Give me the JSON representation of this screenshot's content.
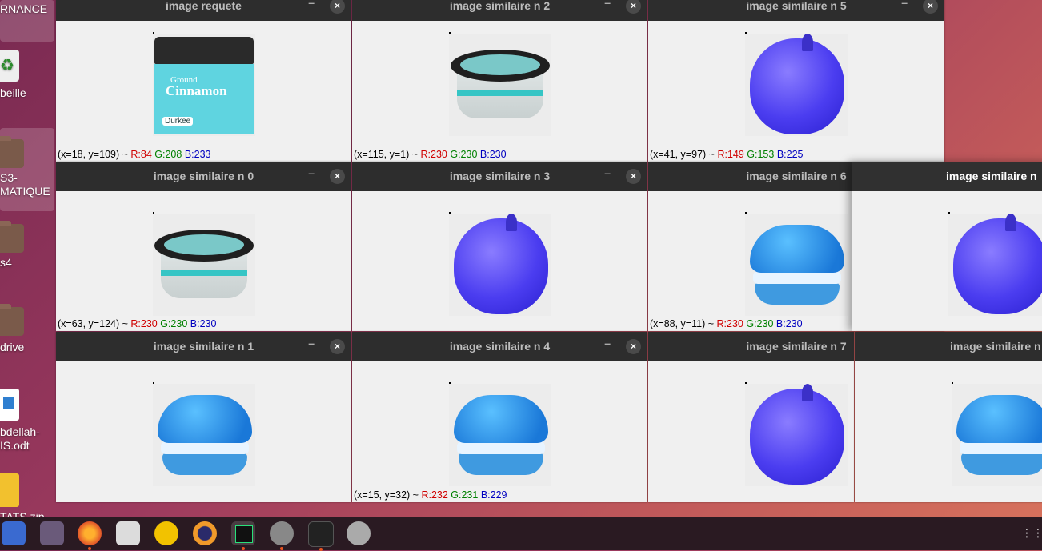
{
  "desktop": {
    "items": [
      {
        "label": "RNANCE"
      },
      {
        "label": "beille"
      },
      {
        "label": "S3-\nMATIQUE"
      },
      {
        "label": "s4"
      },
      {
        "label": "drive"
      },
      {
        "label": "bdellah-\nIS.odt"
      },
      {
        "label": "TATS.zip"
      }
    ]
  },
  "windows": [
    {
      "title": "image requete",
      "status": {
        "coord": "(x=18, y=109) ~",
        "r": "R:84",
        "g": "G:208",
        "b": "B:233"
      }
    },
    {
      "title": "image similaire n 2",
      "status": {
        "coord": "(x=115, y=1) ~",
        "r": "R:230",
        "g": "G:230",
        "b": "B:230"
      }
    },
    {
      "title": "image similaire n 5",
      "status": {
        "coord": "(x=41, y=97) ~",
        "r": "R:149",
        "g": "G:153",
        "b": "B:225"
      }
    },
    {
      "title": "image similaire n 0",
      "status": {
        "coord": "(x=63, y=124) ~",
        "r": "R:230",
        "g": "G:230",
        "b": "B:230"
      }
    },
    {
      "title": "image similaire n 3"
    },
    {
      "title": "image similaire n 6",
      "status": {
        "coord": "(x=88, y=11) ~",
        "r": "R:230",
        "g": "G:230",
        "b": "B:230"
      }
    },
    {
      "title": "image similaire n"
    },
    {
      "title": "image similaire n 1"
    },
    {
      "title": "image similaire n 4",
      "status": {
        "coord": "(x=15, y=32) ~",
        "r": "R:232",
        "g": "G:231",
        "b": "B:229"
      }
    },
    {
      "title": "image similaire n 7"
    },
    {
      "title": "image similaire n"
    }
  ],
  "controls": {
    "minimize": "–",
    "close": "×"
  },
  "can_text": {
    "line1": "Ground",
    "line2": "Cinnamon",
    "brand": "Durkee"
  },
  "dock": {
    "icons": [
      "files-icon",
      "video-icon",
      "firefox-icon",
      "text-editor-icon",
      "mascot-icon",
      "eclipse-icon",
      "pycharm-icon",
      "image-viewer-icon",
      "terminal-icon",
      "disk-icon",
      "apps-grid-icon"
    ]
  }
}
